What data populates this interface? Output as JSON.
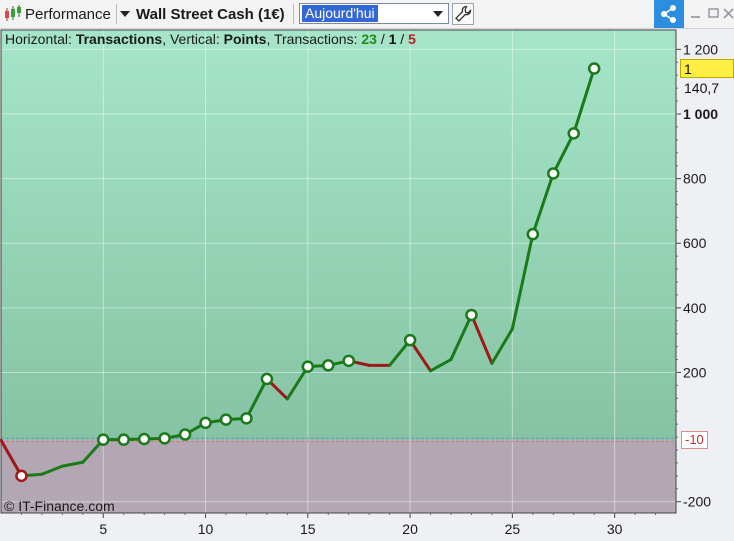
{
  "toolbar": {
    "performance_label": "Performance",
    "instrument_label": "Wall Street Cash (1€)",
    "period_value": "Aujourd'hui"
  },
  "info": {
    "horizontal_prefix": "Horizontal: ",
    "horizontal_value": "Transactions",
    "vertical_prefix": ", Vertical: ",
    "vertical_value": "Points",
    "transactions_prefix": ", Transactions: ",
    "wins": "23",
    "sep1": " / ",
    "neutral": "1",
    "sep2": " / ",
    "losses": "5"
  },
  "copyright": "© IT-Finance.com",
  "last_value_label": "1 140,7",
  "zero_tag_label": "-10",
  "colors": {
    "win": "#1a7a1a",
    "loss": "#a01818",
    "upper_top": "#a6e5c9",
    "upper_bottom": "#86c3a4",
    "lower": "#b2a7b2",
    "share": "#2d8ee0"
  },
  "chart_data": {
    "type": "line",
    "xlim": [
      0,
      33
    ],
    "ylim": [
      -235,
      1260
    ],
    "zero_line": -10,
    "y_ticks": [
      {
        "value": 1200,
        "label": "1 200",
        "bold": false
      },
      {
        "value": 1000,
        "label": "1 000",
        "bold": true
      },
      {
        "value": 800,
        "label": "800",
        "bold": false
      },
      {
        "value": 600,
        "label": "600",
        "bold": false
      },
      {
        "value": 400,
        "label": "400",
        "bold": false
      },
      {
        "value": 200,
        "label": "200",
        "bold": false
      },
      {
        "value": -200,
        "label": "-200",
        "bold": false
      }
    ],
    "x_ticks": [
      {
        "value": 5,
        "label": "5"
      },
      {
        "value": 10,
        "label": "10"
      },
      {
        "value": 15,
        "label": "15"
      },
      {
        "value": 20,
        "label": "20"
      },
      {
        "value": 25,
        "label": "25"
      },
      {
        "value": 30,
        "label": "30"
      }
    ],
    "points": [
      {
        "x": 0,
        "y": -10,
        "marker": false
      },
      {
        "x": 1,
        "y": -120,
        "marker": "loss"
      },
      {
        "x": 2,
        "y": -115,
        "marker": false
      },
      {
        "x": 3,
        "y": -90,
        "marker": false
      },
      {
        "x": 4,
        "y": -78,
        "marker": false
      },
      {
        "x": 5,
        "y": -8,
        "marker": "win"
      },
      {
        "x": 6,
        "y": -8,
        "marker": "win"
      },
      {
        "x": 7,
        "y": -6,
        "marker": "win"
      },
      {
        "x": 8,
        "y": -4,
        "marker": "win"
      },
      {
        "x": 9,
        "y": 8,
        "marker": "win"
      },
      {
        "x": 10,
        "y": 44,
        "marker": "win"
      },
      {
        "x": 11,
        "y": 54,
        "marker": "win"
      },
      {
        "x": 12,
        "y": 58,
        "marker": "win"
      },
      {
        "x": 13,
        "y": 180,
        "marker": "win"
      },
      {
        "x": 14,
        "y": 118,
        "marker": false
      },
      {
        "x": 15,
        "y": 218,
        "marker": "win"
      },
      {
        "x": 16,
        "y": 222,
        "marker": "win"
      },
      {
        "x": 17,
        "y": 236,
        "marker": "win"
      },
      {
        "x": 18,
        "y": 222,
        "marker": false
      },
      {
        "x": 19,
        "y": 222,
        "marker": false
      },
      {
        "x": 20,
        "y": 300,
        "marker": "win"
      },
      {
        "x": 21,
        "y": 205,
        "marker": false
      },
      {
        "x": 22,
        "y": 240,
        "marker": false
      },
      {
        "x": 23,
        "y": 378,
        "marker": "win"
      },
      {
        "x": 24,
        "y": 228,
        "marker": false
      },
      {
        "x": 25,
        "y": 335,
        "marker": false
      },
      {
        "x": 26,
        "y": 628,
        "marker": "win"
      },
      {
        "x": 27,
        "y": 816,
        "marker": "win"
      },
      {
        "x": 28,
        "y": 940,
        "marker": "win"
      },
      {
        "x": 29,
        "y": 1140.7,
        "marker": "win"
      }
    ],
    "segment_colors": [
      "loss",
      "win",
      "win",
      "win",
      "win",
      "win",
      "win",
      "win",
      "win",
      "win",
      "win",
      "win",
      "win",
      "loss",
      "win",
      "win",
      "win",
      "loss",
      "loss",
      "win",
      "loss",
      "win",
      "win",
      "loss",
      "win",
      "win",
      "win",
      "win",
      "win"
    ]
  }
}
